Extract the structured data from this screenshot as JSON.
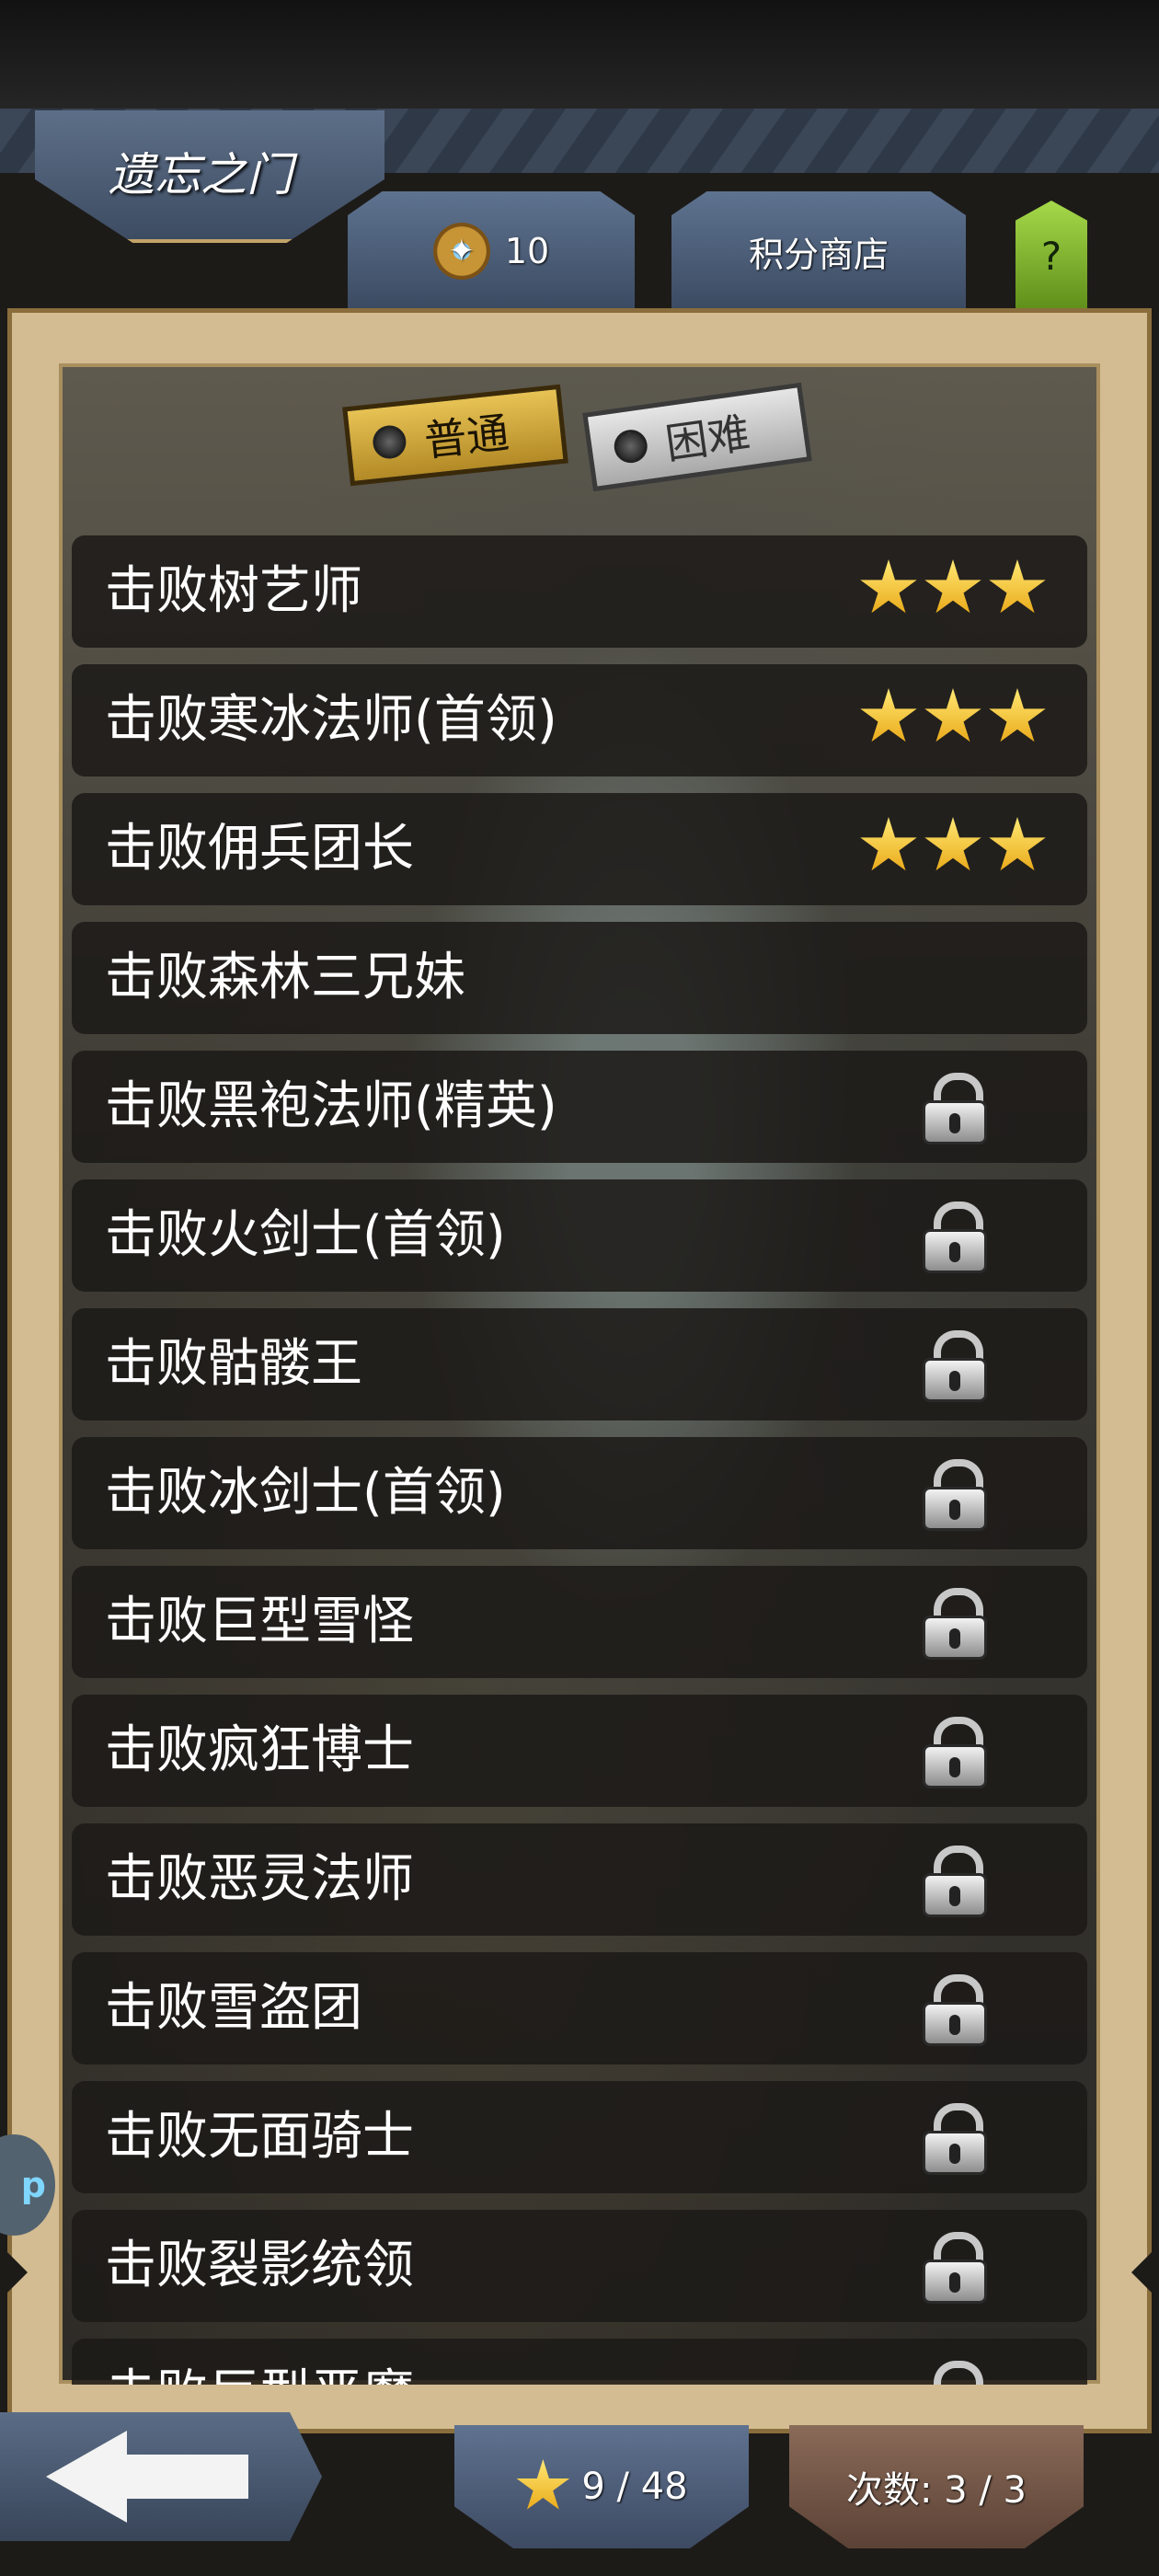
{
  "header": {
    "title": "遗忘之门"
  },
  "top_buttons": {
    "points": "10",
    "points_icon": "medal-icon",
    "shop_label": "积分商店",
    "help_label": "?"
  },
  "tabs": {
    "normal": "普通",
    "hard": "困难",
    "selected": "普通"
  },
  "quests": [
    {
      "label": "击败树艺师",
      "stars": 3,
      "locked": false
    },
    {
      "label": "击败寒冰法师(首领)",
      "stars": 3,
      "locked": false
    },
    {
      "label": "击败佣兵团长",
      "stars": 3,
      "locked": false
    },
    {
      "label": "击败森林三兄妹",
      "stars": 0,
      "locked": false
    },
    {
      "label": "击败黑袍法师(精英)",
      "stars": 0,
      "locked": true
    },
    {
      "label": "击败火剑士(首领)",
      "stars": 0,
      "locked": true
    },
    {
      "label": "击败骷髅王",
      "stars": 0,
      "locked": true
    },
    {
      "label": "击败冰剑士(首领)",
      "stars": 0,
      "locked": true
    },
    {
      "label": "击败巨型雪怪",
      "stars": 0,
      "locked": true
    },
    {
      "label": "击败疯狂博士",
      "stars": 0,
      "locked": true
    },
    {
      "label": "击败恶灵法师",
      "stars": 0,
      "locked": true
    },
    {
      "label": "击败雪盗团",
      "stars": 0,
      "locked": true
    },
    {
      "label": "击败无面骑士",
      "stars": 0,
      "locked": true
    },
    {
      "label": "击败裂影统领",
      "stars": 0,
      "locked": true
    },
    {
      "label": "击败巨型恶魔",
      "stars": 0,
      "locked": true
    }
  ],
  "footer": {
    "star_count": "9 / 48",
    "attempts": "次数: 3 / 3"
  },
  "side_bubble": "p",
  "colors": {
    "star": "#f5c52e",
    "tab_normal": "#d9ad3c",
    "tab_hard": "#c9c9c9",
    "panel_border": "#d3bc92"
  }
}
